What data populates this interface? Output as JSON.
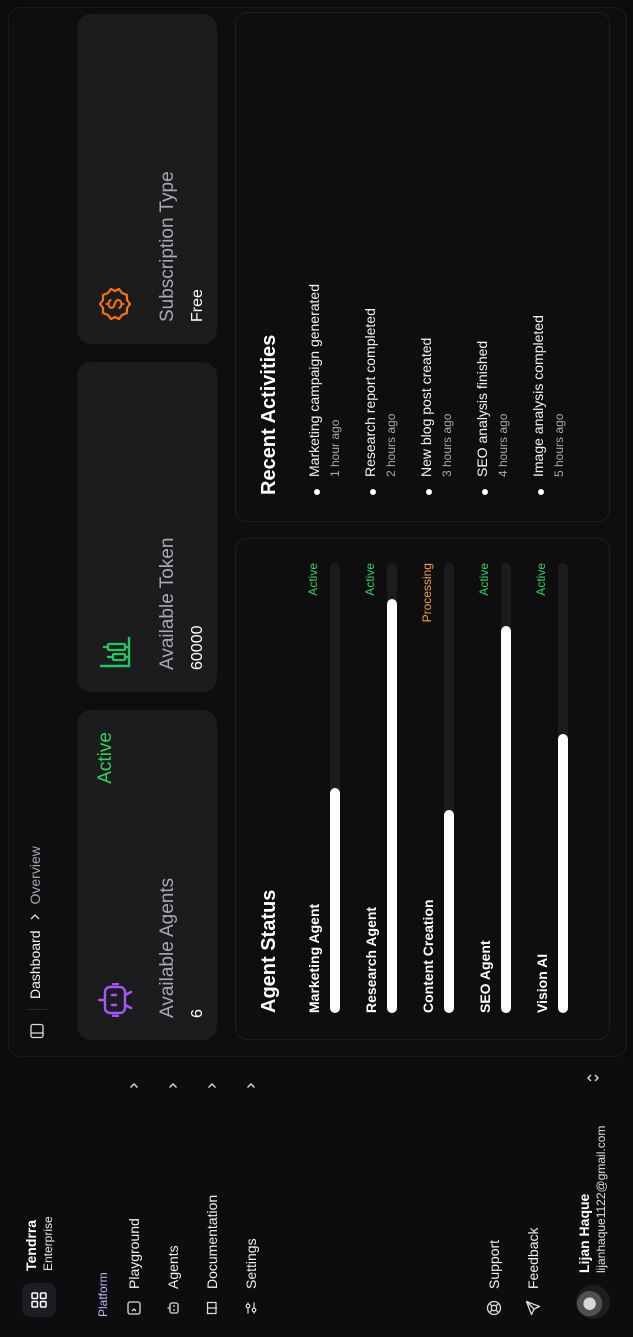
{
  "app": {
    "name": "Tendrra",
    "plan": "Enterprise"
  },
  "sidebar": {
    "section_label": "Platform",
    "items": [
      {
        "label": "Playground",
        "icon": "terminal-icon"
      },
      {
        "label": "Agents",
        "icon": "bot-icon"
      },
      {
        "label": "Documentation",
        "icon": "book-icon"
      },
      {
        "label": "Settings",
        "icon": "sliders-icon"
      }
    ],
    "secondary": [
      {
        "label": "Support",
        "icon": "lifebuoy-icon"
      },
      {
        "label": "Feedback",
        "icon": "send-icon"
      }
    ],
    "user": {
      "name": "Lijan Haque",
      "email": "lijanhaque1122@gmail.com"
    }
  },
  "header": {
    "breadcrumb": [
      "Dashboard",
      "Overview"
    ]
  },
  "cards": [
    {
      "title": "Available Agents",
      "value": "6",
      "state": "Active",
      "icon": "bot-icon",
      "color": "#a855f7"
    },
    {
      "title": "Available Token",
      "value": "60000",
      "icon": "bar-chart-icon",
      "color": "#22c55e"
    },
    {
      "title": "Subscription Type",
      "value": "Free",
      "icon": "dollar-icon",
      "color": "#f97316"
    }
  ],
  "agent_status": {
    "title": "Agent Status",
    "agents": [
      {
        "name": "Marketing Agent",
        "status": "Active",
        "progress": 0.5
      },
      {
        "name": "Research Agent",
        "status": "Active",
        "progress": 0.92
      },
      {
        "name": "Content Creation",
        "status": "Processing",
        "progress": 0.45
      },
      {
        "name": "SEO Agent",
        "status": "Active",
        "progress": 0.86
      },
      {
        "name": "Vision AI",
        "status": "Active",
        "progress": 0.62
      }
    ]
  },
  "activities": {
    "title": "Recent Activities",
    "items": [
      {
        "text": "Marketing campaign generated",
        "time": "1 hour ago"
      },
      {
        "text": "Research report completed",
        "time": "2 hours ago"
      },
      {
        "text": "New blog post created",
        "time": "3 hours ago"
      },
      {
        "text": "SEO analysis finished",
        "time": "4 hours ago"
      },
      {
        "text": "Image analysis completed",
        "time": "5 hours ago"
      }
    ]
  },
  "colors": {
    "active": "#36d05b",
    "processing": "#f5a04a",
    "accent": "#b9b7ff"
  }
}
